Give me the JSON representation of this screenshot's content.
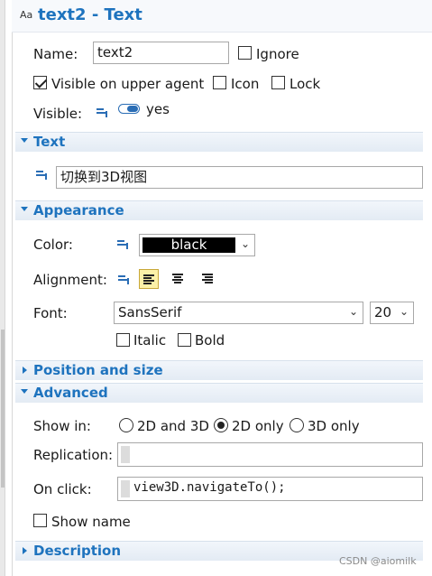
{
  "header": {
    "icon_text": "Aa",
    "title": "text2 - Text"
  },
  "general": {
    "name_label": "Name:",
    "name_value": "text2",
    "ignore_label": "Ignore",
    "visible_upper_label": "Visible on upper agent",
    "icon_label": "Icon",
    "lock_label": "Lock",
    "visible_label": "Visible:",
    "visible_value": "yes"
  },
  "sections": {
    "text": "Text",
    "appearance": "Appearance",
    "position_size": "Position and size",
    "advanced": "Advanced",
    "description": "Description"
  },
  "text_section": {
    "value": "切换到3D视图"
  },
  "appearance": {
    "color_label": "Color:",
    "color_value": "black",
    "alignment_label": "Alignment:",
    "font_label": "Font:",
    "font_value": "SansSerif",
    "font_size": "20",
    "italic_label": "Italic",
    "bold_label": "Bold"
  },
  "advanced": {
    "show_in_label": "Show in:",
    "opt_2d3d": "2D and 3D",
    "opt_2donly": "2D only",
    "opt_3donly": "3D only",
    "replication_label": "Replication:",
    "onclick_label": "On click:",
    "onclick_code": "view3D.navigateTo();",
    "show_name_label": "Show name"
  },
  "watermark": "CSDN @aiomilk"
}
